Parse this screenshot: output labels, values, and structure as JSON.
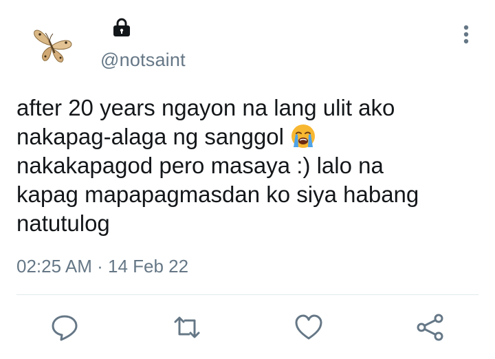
{
  "author": {
    "handle": "@notsaint",
    "avatar_icon": "butterfly-avatar",
    "protected_icon": "lock-icon"
  },
  "tweet": {
    "text_part1": "after 20 years ngayon na lang ulit ako\nnakapag-alaga ng sanggol ",
    "emoji": "loudly-crying-face-emoji",
    "text_part2": "\nnakakapagod pero masaya :) lalo na\nkapag mapapagmasdan ko siya habang\nnatutulog",
    "time": "02:25 AM",
    "separator": "·",
    "date": "14 Feb 22"
  },
  "actions": {
    "reply_icon": "reply-icon",
    "retweet_icon": "retweet-icon",
    "like_icon": "heart-icon",
    "share_icon": "share-icon",
    "more_icon": "more-vertical-icon"
  },
  "colors": {
    "text": "#14171a",
    "secondary": "#657786",
    "divider": "#e1e8ed"
  }
}
